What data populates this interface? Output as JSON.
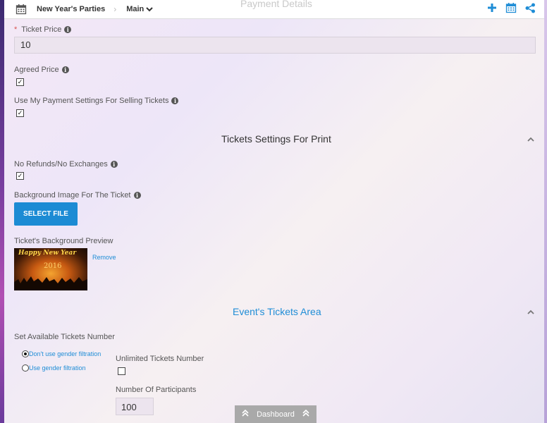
{
  "header": {
    "breadcrumb_event": "New Year's Parties",
    "breadcrumb_section": "Main",
    "ghost_title": "Payment Details",
    "icons": [
      "calendar-icon",
      "plus-icon",
      "calendar-icon",
      "share-icon"
    ]
  },
  "payment": {
    "ticket_price_label": "Ticket Price",
    "ticket_price_value": "10",
    "agreed_price_label": "Agreed Price",
    "agreed_price_checked": true,
    "use_payment_settings_label": "Use My Payment Settings For Selling Tickets",
    "use_payment_settings_checked": true
  },
  "print_settings": {
    "title": "Tickets Settings For Print",
    "no_refunds_label": "No Refunds/No Exchanges",
    "no_refunds_checked": true,
    "bg_image_label": "Background Image For The Ticket",
    "select_file_label": "SELECT FILE",
    "preview_label": "Ticket's Background Preview",
    "preview_image_text": "Happy New Year",
    "preview_image_year": "2016",
    "remove_label": "Remove"
  },
  "tickets_area": {
    "title": "Event's Tickets Area",
    "available_label": "Set Available Tickets Number",
    "radio_options": [
      {
        "label": "Don't use gender filtration",
        "selected": true
      },
      {
        "label": "Use gender filtration",
        "selected": false
      }
    ],
    "unlimited_label": "Unlimited Tickets Number",
    "unlimited_checked": false,
    "participants_label": "Number Of Participants",
    "participants_value": "100"
  },
  "footer": {
    "dashboard_label": "Dashboard"
  },
  "colors": {
    "accent": "#1f8dd6",
    "required": "#d9534f"
  }
}
